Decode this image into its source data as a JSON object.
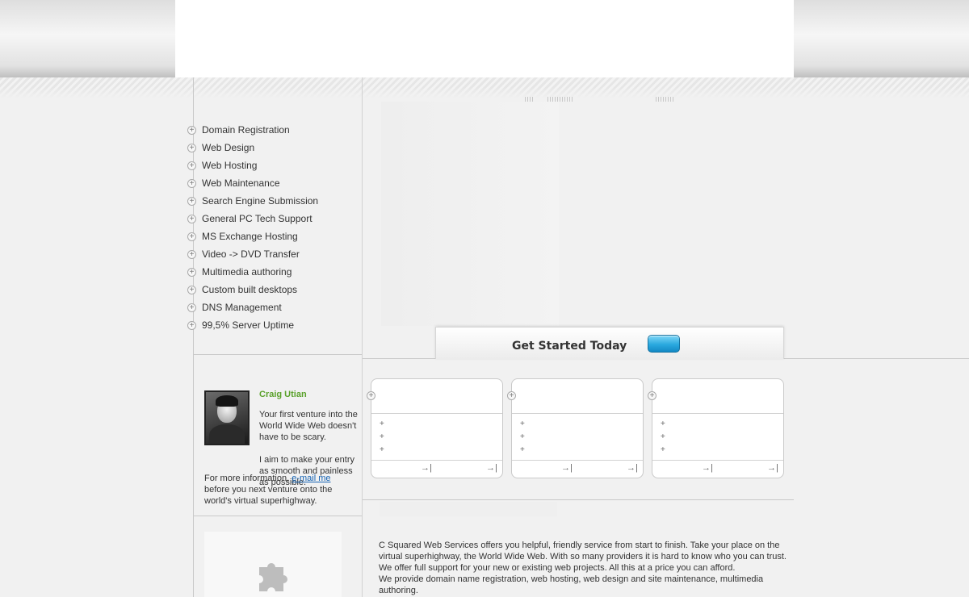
{
  "menu": {
    "items": [
      {
        "label": "Domain Registration"
      },
      {
        "label": "Web Design"
      },
      {
        "label": "Web Hosting"
      },
      {
        "label": "Web Maintenance"
      },
      {
        "label": "Search Engine Submission"
      },
      {
        "label": "General PC Tech Support"
      },
      {
        "label": "MS Exchange Hosting"
      },
      {
        "label": "Video -> DVD Transfer"
      },
      {
        "label": "Multimedia authoring"
      },
      {
        "label": "Custom built desktops"
      },
      {
        "label": "DNS Management"
      },
      {
        "label": "99,5% Server Uptime"
      }
    ]
  },
  "profile": {
    "name": "Craig Utian",
    "text_line1": "Your first venture into the World Wide Web doesn't have to be scary.",
    "text_line2": "I aim to make your entry as smooth and painless as possible.",
    "more_info_prefix": "For more information, ",
    "email_link": "e-mail me",
    "more_info_suffix": "before you next venture onto the world's virtual superhighway."
  },
  "get_started": {
    "label": "Get Started Today"
  },
  "cards": [
    {
      "bullet": "+",
      "arrow_left": "→|",
      "arrow_right": "→|"
    },
    {
      "bullet": "+",
      "arrow_left": "→|",
      "arrow_right": "→|"
    },
    {
      "bullet": "+",
      "arrow_left": "→|",
      "arrow_right": "→|"
    }
  ],
  "about": {
    "paragraph1": "C Squared Web Services offers you helpful, friendly service from start to finish. Take your place on the virtual superhighway, the World Wide Web. With so many providers it is hard to know who you can trust. We offer full support for your new or existing web projects. All this at a price you can afford.",
    "paragraph2": "We provide domain name registration, web hosting, web design and site maintenance, multimedia authoring."
  },
  "colors": {
    "accent_green": "#5aa12b",
    "link_blue": "#1663b3",
    "button_blue": "#2aa9df"
  },
  "icons": {
    "menu_bullet": "plus-circle-icon",
    "card_arrow": "arrow-to-end-icon",
    "puzzle": "puzzle-piece-icon"
  }
}
